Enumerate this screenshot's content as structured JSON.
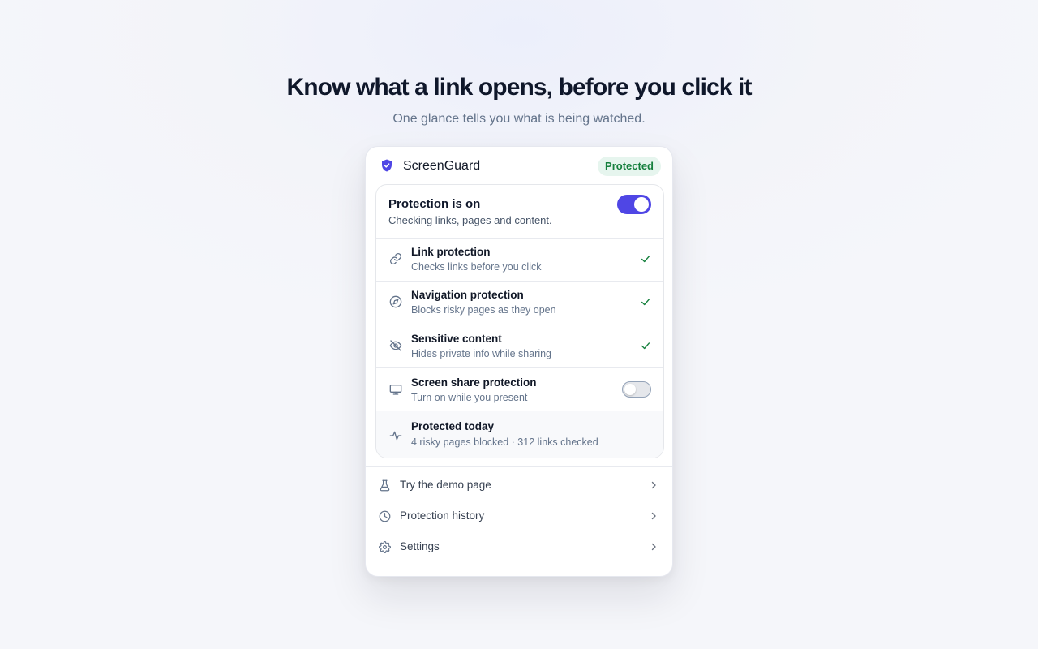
{
  "hero": {
    "title": "Know what a link opens, before you click it",
    "subtitle": "One glance tells you what is being watched."
  },
  "popup": {
    "brand": {
      "name": "ScreenGuard",
      "icon": "shield-check-icon",
      "color": "#4f46e5"
    },
    "status_badge": "Protected",
    "main_toggle": {
      "title": "Protection is on",
      "subtitle": "Checking links, pages and content.",
      "enabled": true
    },
    "features": [
      {
        "title": "Link protection",
        "subtitle": "Checks links before you click",
        "icon": "link-icon",
        "state": "checked"
      },
      {
        "title": "Navigation protection",
        "subtitle": "Blocks risky pages as they open",
        "icon": "compass-icon",
        "state": "checked"
      },
      {
        "title": "Sensitive content",
        "subtitle": "Hides private info while sharing",
        "icon": "eye-off-icon",
        "state": "checked"
      },
      {
        "title": "Screen share protection",
        "subtitle": "Turn on while you present",
        "icon": "monitor-icon",
        "state": "toggle-off"
      }
    ],
    "stats": {
      "title": "Protected today",
      "subtitle": "4 risky pages blocked · 312 links checked",
      "icon": "activity-icon"
    },
    "menu": [
      {
        "label": "Try the demo page",
        "icon": "flask-icon"
      },
      {
        "label": "Protection history",
        "icon": "clock-icon"
      },
      {
        "label": "Settings",
        "icon": "gear-icon"
      }
    ]
  },
  "colors": {
    "accent": "#4f46e5",
    "success": "#15803d",
    "success_bg": "#e6f5ee",
    "check": "#15803d"
  }
}
